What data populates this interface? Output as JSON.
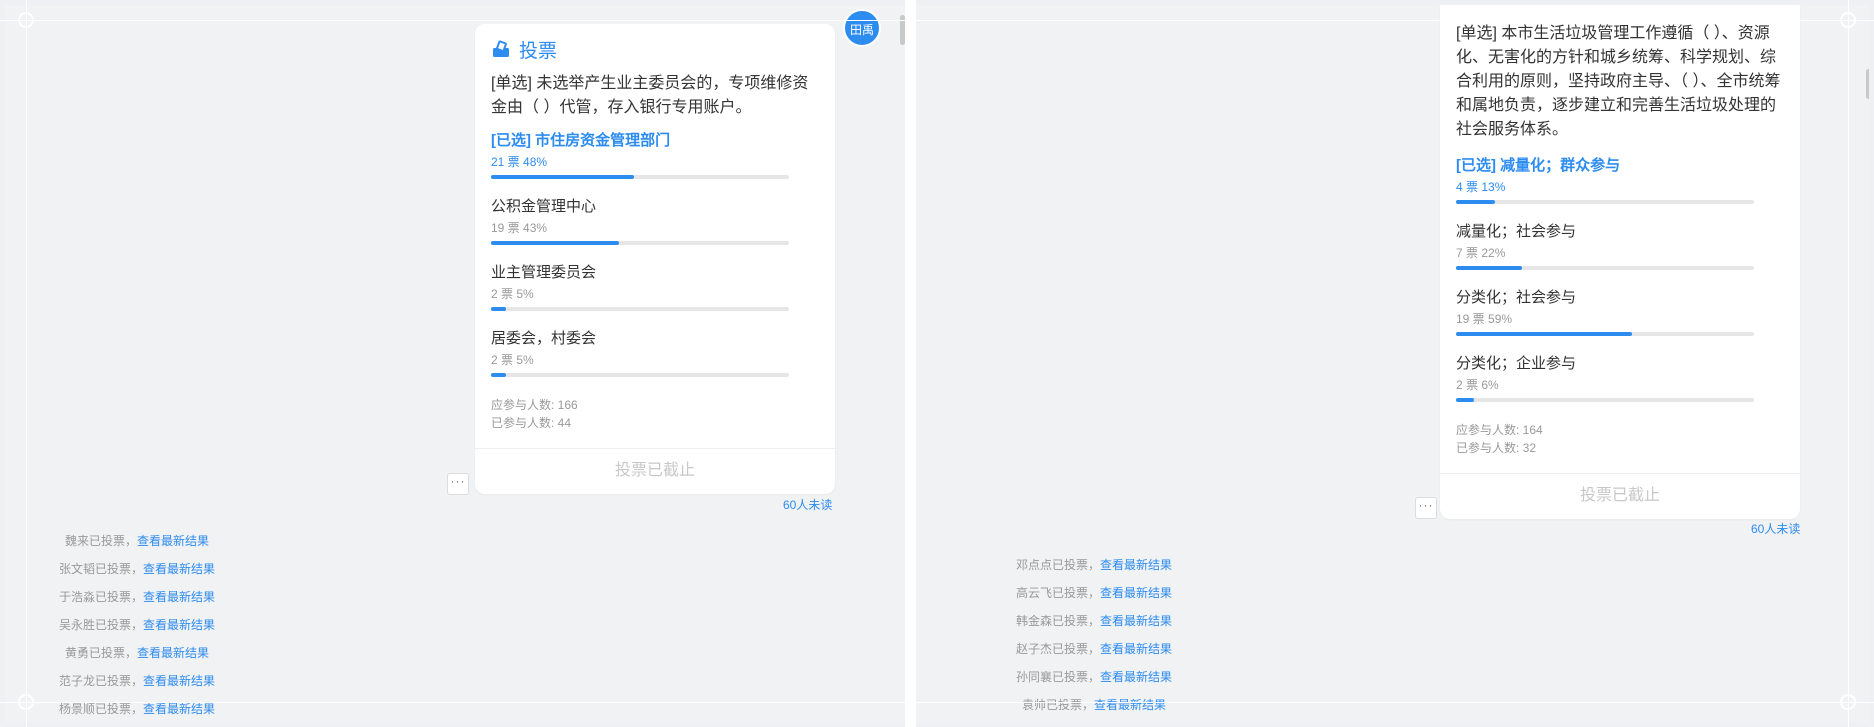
{
  "left": {
    "avatar_text": "田禹",
    "title": "投票",
    "question": "[单选] 未选举产生业主委员会的，专项维修资金由（  ）代管，存入银行专用账户。",
    "options": [
      {
        "label": "[已选] 市住房资金管理部门",
        "stats": "21 票  48%",
        "percent": 48,
        "selected": true
      },
      {
        "label": "公积金管理中心",
        "stats": "19 票  43%",
        "percent": 43,
        "selected": false
      },
      {
        "label": "业主管理委员会",
        "stats": "2 票  5%",
        "percent": 5,
        "selected": false
      },
      {
        "label": "居委会，村委会",
        "stats": "2 票  5%",
        "percent": 5,
        "selected": false
      }
    ],
    "should_participate": "应参与人数: 166",
    "participated": "已参与人数: 44",
    "footer": "投票已截止",
    "more": "···",
    "unread": "60人未读",
    "logs": [
      {
        "name": "魏来已投票，",
        "link": "查看最新结果"
      },
      {
        "name": "张文韬已投票，",
        "link": "查看最新结果"
      },
      {
        "name": "于浩淼已投票，",
        "link": "查看最新结果"
      },
      {
        "name": "吴永胜已投票，",
        "link": "查看最新结果"
      },
      {
        "name": "黄勇已投票，",
        "link": "查看最新结果"
      },
      {
        "name": "范子龙已投票，",
        "link": "查看最新结果"
      },
      {
        "name": "杨景顺已投票，",
        "link": "查看最新结果"
      }
    ]
  },
  "right": {
    "question": "[单选] 本市生活垃圾管理工作遵循（  ）、资源化、无害化的方针和城乡统筹、科学规划、综合利用的原则，坚持政府主导、（  ）、全市统筹和属地负责，逐步建立和完善生活垃圾处理的社会服务体系。",
    "options": [
      {
        "label": "[已选] 减量化；群众参与",
        "stats": "4 票  13%",
        "percent": 13,
        "selected": true
      },
      {
        "label": "减量化；社会参与",
        "stats": "7 票  22%",
        "percent": 22,
        "selected": false
      },
      {
        "label": "分类化；社会参与",
        "stats": "19 票  59%",
        "percent": 59,
        "selected": false
      },
      {
        "label": "分类化；企业参与",
        "stats": "2 票  6%",
        "percent": 6,
        "selected": false
      }
    ],
    "should_participate": "应参与人数: 164",
    "participated": "已参与人数: 32",
    "footer": "投票已截止",
    "more": "···",
    "unread": "60人未读",
    "logs": [
      {
        "name": "邓点点已投票，",
        "link": "查看最新结果"
      },
      {
        "name": "高云飞已投票，",
        "link": "查看最新结果"
      },
      {
        "name": "韩金森已投票，",
        "link": "查看最新结果"
      },
      {
        "name": "赵子杰已投票，",
        "link": "查看最新结果"
      },
      {
        "name": "孙同襄已投票，",
        "link": "查看最新结果"
      },
      {
        "name": "袁帅已投票，",
        "link": "查看最新结果"
      }
    ]
  },
  "colors": {
    "accent": "#2d8cf0",
    "muted": "#999999",
    "background": "#f1f2f4"
  }
}
